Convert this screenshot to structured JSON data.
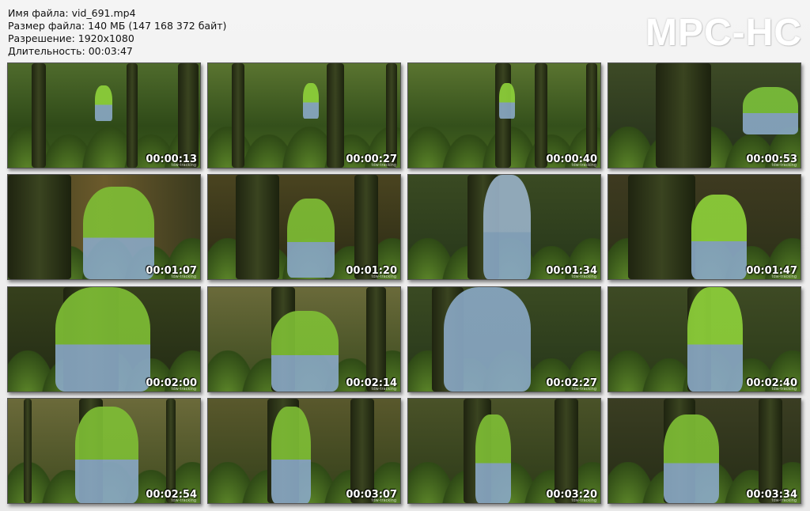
{
  "file_info": {
    "name_line": "Имя файла: vid_691.mp4",
    "size_line": "Размер файла: 140 МБ (147 168 372 байт)",
    "resolution_line": "Разрешение: 1920x1080",
    "duration_line": "Длительность: 00:03:47"
  },
  "logo": "MPC-HC",
  "thumbnails": [
    {
      "timestamp": "00:00:13",
      "watermark": "tdw-tracking"
    },
    {
      "timestamp": "00:00:27",
      "watermark": "tdw-tracking"
    },
    {
      "timestamp": "00:00:40",
      "watermark": "tdw-tracking"
    },
    {
      "timestamp": "00:00:53",
      "watermark": "tdw-tracking"
    },
    {
      "timestamp": "00:01:07",
      "watermark": "tdw-tracking"
    },
    {
      "timestamp": "00:01:20",
      "watermark": "tdw-tracking"
    },
    {
      "timestamp": "00:01:34",
      "watermark": "tdw-tracking"
    },
    {
      "timestamp": "00:01:47",
      "watermark": "tdw-tracking"
    },
    {
      "timestamp": "00:02:00",
      "watermark": "tdw-tracking"
    },
    {
      "timestamp": "00:02:14",
      "watermark": "tdw-tracking"
    },
    {
      "timestamp": "00:02:27",
      "watermark": "tdw-tracking"
    },
    {
      "timestamp": "00:02:40",
      "watermark": "tdw-tracking"
    },
    {
      "timestamp": "00:02:54",
      "watermark": "tdw-tracking"
    },
    {
      "timestamp": "00:03:07",
      "watermark": "tdw-tracking"
    },
    {
      "timestamp": "00:03:20",
      "watermark": "tdw-tracking"
    },
    {
      "timestamp": "00:03:34",
      "watermark": "tdw-tracking"
    }
  ]
}
